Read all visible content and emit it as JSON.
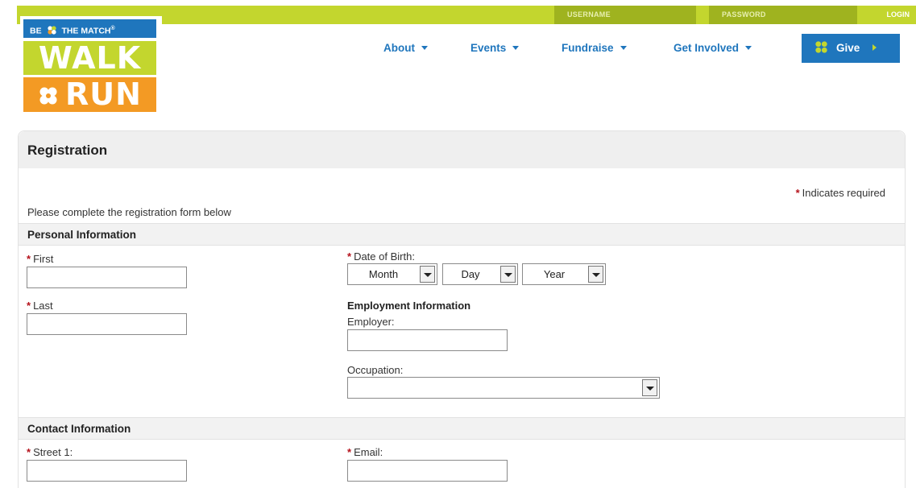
{
  "topbar": {
    "username_placeholder": "USERNAME",
    "password_placeholder": "PASSWORD",
    "login_label": "LOGIN"
  },
  "logo": {
    "tagline_left": "BE",
    "tagline_right": "THE MATCH",
    "tagline_mark": "®",
    "walk": "WALK",
    "run": "RUN"
  },
  "nav": {
    "items": [
      {
        "label": "About"
      },
      {
        "label": "Events"
      },
      {
        "label": "Fundraise"
      },
      {
        "label": "Get Involved"
      }
    ],
    "give_label": "Give"
  },
  "registration": {
    "title": "Registration",
    "required_note": "Indicates required",
    "required_mark": "*",
    "intro": "Please complete the registration form below",
    "personal": {
      "heading": "Personal Information",
      "first_label": "First",
      "last_label": "Last",
      "dob_label": "Date of Birth:",
      "month": "Month",
      "day": "Day",
      "year": "Year",
      "employment_heading": "Employment Information",
      "employer_label": "Employer:",
      "occupation_label": "Occupation:",
      "occupation_value": ""
    },
    "contact": {
      "heading": "Contact Information",
      "street_label": "Street 1:",
      "email_label": "Email:"
    }
  },
  "colors": {
    "brand_green": "#c3d62e",
    "brand_dark_green": "#9fb31f",
    "brand_blue": "#1f76bd",
    "brand_orange": "#f39a24",
    "required_red": "#b5121b"
  }
}
